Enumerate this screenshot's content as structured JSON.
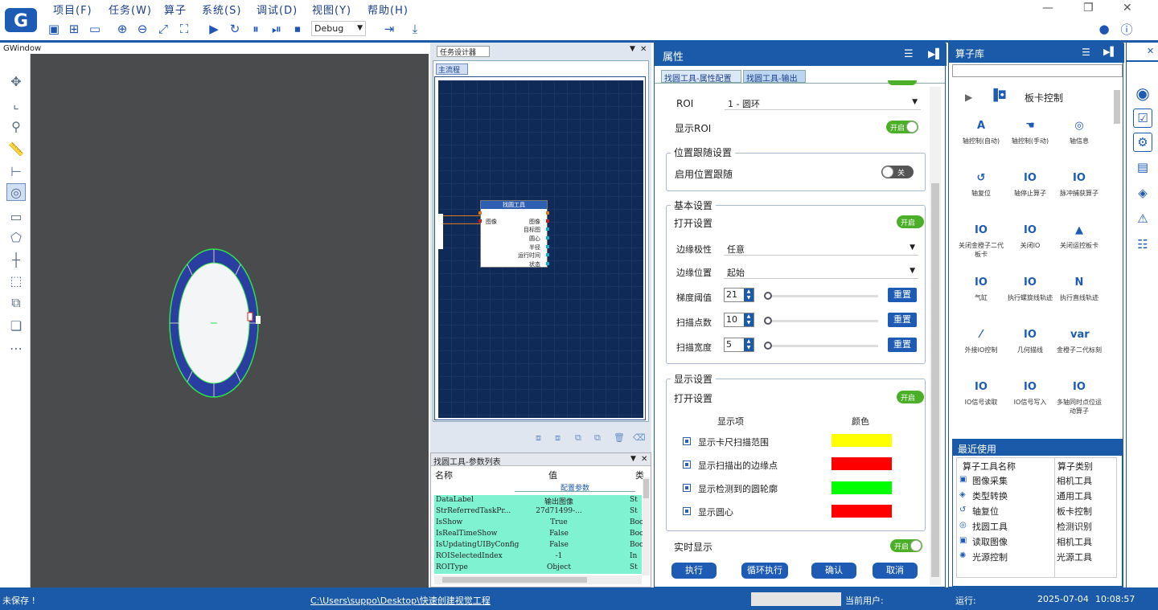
{
  "menu": [
    "项目(F)",
    "任务(W)",
    "算子",
    "系统(S)",
    "调试(D)",
    "视图(Y)",
    "帮助(H)"
  ],
  "toolbar": {
    "mode": "Debug"
  },
  "gwindow": {
    "title": "GWindow"
  },
  "task_designer": {
    "title": "任务设计器",
    "flow_tab": "主流程",
    "node": {
      "title": "找圆工具",
      "input": "图像",
      "outputs": [
        "图像",
        "目标图",
        "圆心",
        "半径",
        "运行时间",
        "状态"
      ]
    }
  },
  "params": {
    "title": "找圆工具-参数列表",
    "col_name": "名称",
    "col_value": "值",
    "col_type": "类",
    "section": "配置参数",
    "rows": [
      {
        "name": "DataLabel",
        "value": "输出图像",
        "type": "St"
      },
      {
        "name": "StrReferredTaskPr...",
        "value": "27d71499-...",
        "type": "St"
      },
      {
        "name": "IsShow",
        "value": "True",
        "type": "Boo"
      },
      {
        "name": "IsRealTimeShow",
        "value": "False",
        "type": "Boo"
      },
      {
        "name": "IsUpdatingUIByConfig",
        "value": "False",
        "type": "Boo"
      },
      {
        "name": "ROISelectedIndex",
        "value": "-1",
        "type": "In"
      },
      {
        "name": "ROIType",
        "value": "Object",
        "type": "St"
      }
    ]
  },
  "props": {
    "title": "属性",
    "tabs": [
      "找圆工具-属性配置",
      "找圆工具-输出"
    ],
    "roi_label": "ROI",
    "roi_value": "1 - 圆环",
    "show_roi_label": "显示ROI",
    "on": "开启",
    "off": "关闭",
    "pos_group": "位置跟随设置",
    "pos_enable": "启用位置跟随",
    "basic_group": "基本设置",
    "open_setting": "打开设置",
    "edge_polarity": "边缘极性",
    "edge_polarity_value": "任意",
    "edge_position": "边缘位置",
    "edge_position_value": "起始",
    "grad_threshold": "梯度阈值",
    "grad_threshold_value": "21",
    "scan_points": "扫描点数",
    "scan_points_value": "10",
    "scan_width": "扫描宽度",
    "scan_width_value": "5",
    "reset": "重置",
    "display_group": "显示设置",
    "display_item": "显示项",
    "color": "颜色",
    "display_rows": [
      {
        "label": "显示卡尺扫描范围",
        "color": "#ffff00"
      },
      {
        "label": "显示扫描出的边缘点",
        "color": "#ff0000"
      },
      {
        "label": "显示检测到的圆轮廓",
        "color": "#00ff00"
      },
      {
        "label": "显示圆心",
        "color": "#ff0000"
      }
    ],
    "realtime": "实时显示",
    "actions": [
      "执行",
      "循环执行",
      "确认",
      "取消"
    ]
  },
  "library": {
    "title": "算子库",
    "category": "板卡控制",
    "ops": [
      {
        "label": "轴控制(自动)",
        "icon": "A"
      },
      {
        "label": "轴控制(手动)",
        "icon": "☚"
      },
      {
        "label": "轴信息",
        "icon": "◎"
      },
      {
        "label": "轴复位",
        "icon": "↺"
      },
      {
        "label": "轴停止算子",
        "icon": "IO"
      },
      {
        "label": "脉冲捕获算子",
        "icon": "IO"
      },
      {
        "label": "关闭金橙子二代板卡",
        "icon": "IO"
      },
      {
        "label": "关闭IO",
        "icon": "IO"
      },
      {
        "label": "关闭运控板卡",
        "icon": "▲"
      },
      {
        "label": "气缸",
        "icon": "IO"
      },
      {
        "label": "执行螺旋线轨迹",
        "icon": "IO"
      },
      {
        "label": "执行直线轨迹",
        "icon": "N"
      },
      {
        "label": "外接IO控制",
        "icon": "⁄"
      },
      {
        "label": "几何描线",
        "icon": "IO"
      },
      {
        "label": "金橙子二代标刻",
        "icon": "var"
      },
      {
        "label": "IO信号读取",
        "icon": "IO"
      },
      {
        "label": "IO信号写入",
        "icon": "IO"
      },
      {
        "label": "多轴同时点位运动算子",
        "icon": "IO"
      }
    ],
    "recent_title": "最近使用",
    "recent_cols": [
      "算子工具名称",
      "算子类别"
    ],
    "recent": [
      {
        "name": "图像采集",
        "cat": "相机工具",
        "icon": "▣"
      },
      {
        "name": "类型转换",
        "cat": "通用工具",
        "icon": "◈"
      },
      {
        "name": "轴复位",
        "cat": "板卡控制",
        "icon": "↺"
      },
      {
        "name": "找圆工具",
        "cat": "检测识别",
        "icon": "◎"
      },
      {
        "name": "读取图像",
        "cat": "相机工具",
        "icon": "▣"
      },
      {
        "name": "光源控制",
        "cat": "光源工具",
        "icon": "✺"
      }
    ]
  },
  "status": {
    "save": "未保存 !",
    "path": "C:\\Users\\suppo\\Desktop\\快速创建视觉工程",
    "user": "当前用户:",
    "run": "运行:",
    "date": "2025-07-04",
    "time": "10:08:57"
  }
}
